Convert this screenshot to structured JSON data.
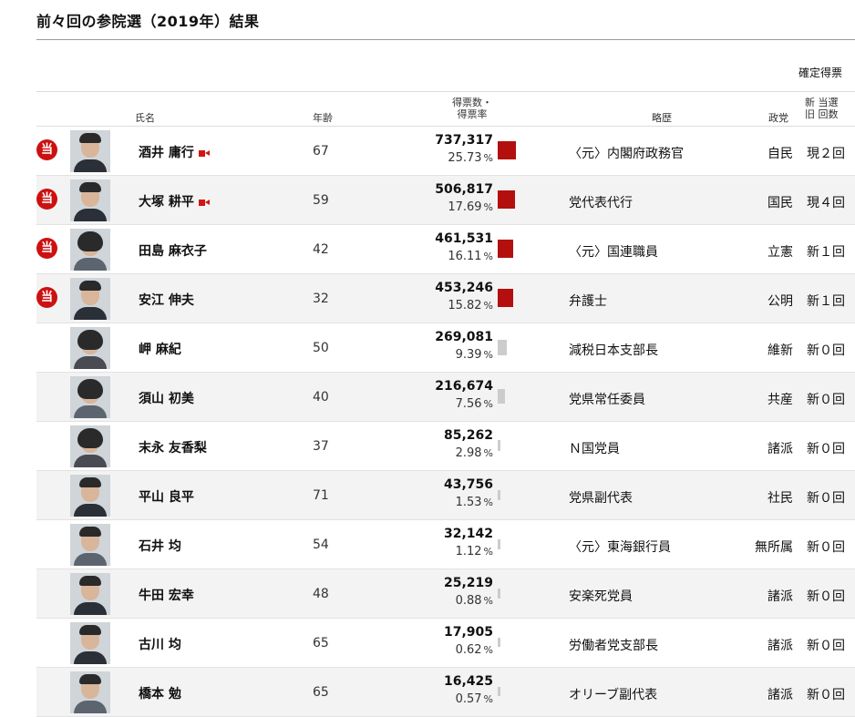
{
  "page": {
    "title": "前々回の参院選（2019年）結果",
    "status": "確定得票"
  },
  "header": {
    "name": "氏名",
    "age": "年齢",
    "votes_line1": "得票数・",
    "votes_line2": "得票率",
    "career": "略歴",
    "party": "政党",
    "times_line1": "新 当選",
    "times_line2": "旧 回数"
  },
  "elected_mark": "当",
  "candidates": [
    {
      "name": "酒井 庸行",
      "video": true,
      "age": "67",
      "votes": "737,317",
      "pct": "25.73",
      "career": "〈元〉内閣府政務官",
      "party": "自民",
      "times": "現２回",
      "elected": true,
      "gender": "m"
    },
    {
      "name": "大塚 耕平",
      "video": true,
      "age": "59",
      "votes": "506,817",
      "pct": "17.69",
      "career": "党代表代行",
      "party": "国民",
      "times": "現４回",
      "elected": true,
      "gender": "m"
    },
    {
      "name": "田島 麻衣子",
      "video": false,
      "age": "42",
      "votes": "461,531",
      "pct": "16.11",
      "career": "〈元〉国連職員",
      "party": "立憲",
      "times": "新１回",
      "elected": true,
      "gender": "f"
    },
    {
      "name": "安江 伸夫",
      "video": false,
      "age": "32",
      "votes": "453,246",
      "pct": "15.82",
      "career": "弁護士",
      "party": "公明",
      "times": "新１回",
      "elected": true,
      "gender": "m"
    },
    {
      "name": "岬 麻紀",
      "video": false,
      "age": "50",
      "votes": "269,081",
      "pct": "9.39",
      "career": "減税日本支部長",
      "party": "維新",
      "times": "新０回",
      "elected": false,
      "gender": "f"
    },
    {
      "name": "須山 初美",
      "video": false,
      "age": "40",
      "votes": "216,674",
      "pct": "7.56",
      "career": "党県常任委員",
      "party": "共産",
      "times": "新０回",
      "elected": false,
      "gender": "f"
    },
    {
      "name": "末永 友香梨",
      "video": false,
      "age": "37",
      "votes": "85,262",
      "pct": "2.98",
      "career": "Ｎ国党員",
      "party": "諸派",
      "times": "新０回",
      "elected": false,
      "gender": "f"
    },
    {
      "name": "平山 良平",
      "video": false,
      "age": "71",
      "votes": "43,756",
      "pct": "1.53",
      "career": "党県副代表",
      "party": "社民",
      "times": "新０回",
      "elected": false,
      "gender": "m"
    },
    {
      "name": "石井 均",
      "video": false,
      "age": "54",
      "votes": "32,142",
      "pct": "1.12",
      "career": "〈元〉東海銀行員",
      "party": "無所属",
      "times": "新０回",
      "elected": false,
      "gender": "m"
    },
    {
      "name": "牛田 宏幸",
      "video": false,
      "age": "48",
      "votes": "25,219",
      "pct": "0.88",
      "career": "安楽死党員",
      "party": "諸派",
      "times": "新０回",
      "elected": false,
      "gender": "m"
    },
    {
      "name": "古川 均",
      "video": false,
      "age": "65",
      "votes": "17,905",
      "pct": "0.62",
      "career": "労働者党支部長",
      "party": "諸派",
      "times": "新０回",
      "elected": false,
      "gender": "m"
    },
    {
      "name": "橋本 勉",
      "video": false,
      "age": "65",
      "votes": "16,425",
      "pct": "0.57",
      "career": "オリーブ副代表",
      "party": "諸派",
      "times": "新０回",
      "elected": false,
      "gender": "m"
    }
  ],
  "colors": {
    "elected_bar": "#b30f0f",
    "other_bar": "#cccccc",
    "elected_mark": "#cc1111"
  },
  "pct_unit": "%",
  "icons": {
    "video": "video-camera-icon",
    "elected": "elected-stamp-icon",
    "photo": "candidate-photo"
  }
}
